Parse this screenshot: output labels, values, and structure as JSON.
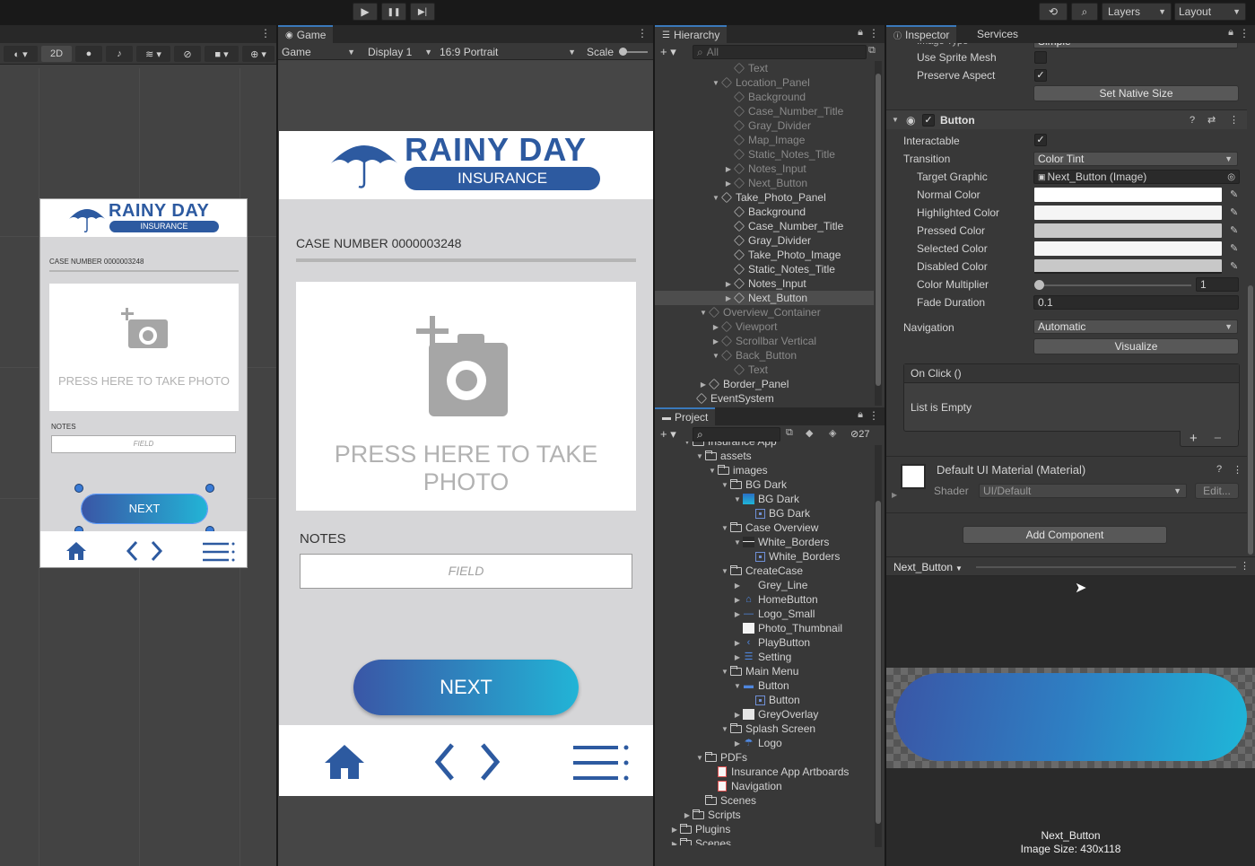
{
  "toolbar": {
    "play_icon": "▶",
    "pause_icon": "❚❚",
    "step_icon": "▶|",
    "layers_label": "Layers",
    "layout_label": "Layout"
  },
  "scene": {
    "mode_2d": "2D",
    "phone": {
      "logo_title": "RAINY DAY",
      "logo_subtitle": "INSURANCE",
      "case_number": "CASE NUMBER 0000003248",
      "photo_text": "PRESS HERE TO TAKE PHOTO",
      "notes_label": "NOTES",
      "field_placeholder": "FIELD",
      "next_label": "NEXT"
    }
  },
  "game": {
    "tab_label": "Game",
    "view_dropdown": "Game",
    "display_dropdown": "Display 1",
    "aspect_dropdown": "16:9 Portrait",
    "scale_label": "Scale",
    "app": {
      "logo_title": "RAINY DAY",
      "logo_subtitle": "INSURANCE",
      "case_number": "CASE NUMBER 0000003248",
      "photo_text": "PRESS HERE TO TAKE PHOTO",
      "notes_label": "NOTES",
      "field_placeholder": "FIELD",
      "next_label": "NEXT"
    }
  },
  "hierarchy": {
    "tab_label": "Hierarchy",
    "search_placeholder": "All",
    "items": [
      {
        "label": "Text",
        "indent": 5,
        "fold": "",
        "dim": true
      },
      {
        "label": "Location_Panel",
        "indent": 4,
        "fold": "▼",
        "dim": true
      },
      {
        "label": "Background",
        "indent": 5,
        "fold": "",
        "dim": true
      },
      {
        "label": "Case_Number_Title",
        "indent": 5,
        "fold": "",
        "dim": true
      },
      {
        "label": "Gray_Divider",
        "indent": 5,
        "fold": "",
        "dim": true
      },
      {
        "label": "Map_Image",
        "indent": 5,
        "fold": "",
        "dim": true
      },
      {
        "label": "Static_Notes_Title",
        "indent": 5,
        "fold": "",
        "dim": true
      },
      {
        "label": "Notes_Input",
        "indent": 5,
        "fold": "▶",
        "dim": true
      },
      {
        "label": "Next_Button",
        "indent": 5,
        "fold": "▶",
        "dim": true
      },
      {
        "label": "Take_Photo_Panel",
        "indent": 4,
        "fold": "▼",
        "dim": false
      },
      {
        "label": "Background",
        "indent": 5,
        "fold": "",
        "dim": false
      },
      {
        "label": "Case_Number_Title",
        "indent": 5,
        "fold": "",
        "dim": false
      },
      {
        "label": "Gray_Divider",
        "indent": 5,
        "fold": "",
        "dim": false
      },
      {
        "label": "Take_Photo_Image",
        "indent": 5,
        "fold": "",
        "dim": false
      },
      {
        "label": "Static_Notes_Title",
        "indent": 5,
        "fold": "",
        "dim": false
      },
      {
        "label": "Notes_Input",
        "indent": 5,
        "fold": "▶",
        "dim": false
      },
      {
        "label": "Next_Button",
        "indent": 5,
        "fold": "▶",
        "dim": false,
        "selected": true
      },
      {
        "label": "Overview_Container",
        "indent": 3,
        "fold": "▼",
        "dim": true
      },
      {
        "label": "Viewport",
        "indent": 4,
        "fold": "▶",
        "dim": true
      },
      {
        "label": "Scrollbar Vertical",
        "indent": 4,
        "fold": "▶",
        "dim": true
      },
      {
        "label": "Back_Button",
        "indent": 4,
        "fold": "▼",
        "dim": true
      },
      {
        "label": "Text",
        "indent": 5,
        "fold": "",
        "dim": true
      },
      {
        "label": "Border_Panel",
        "indent": 3,
        "fold": "▶",
        "dim": false
      },
      {
        "label": "EventSystem",
        "indent": 2,
        "fold": "",
        "dim": false
      }
    ]
  },
  "project": {
    "tab_label": "Project",
    "hidden_count": "27",
    "items": [
      {
        "label": "Insurance App",
        "indent": 1,
        "fold": "▼",
        "type": "folder"
      },
      {
        "label": "assets",
        "indent": 2,
        "fold": "▼",
        "type": "folder"
      },
      {
        "label": "images",
        "indent": 3,
        "fold": "▼",
        "type": "folder"
      },
      {
        "label": "BG Dark",
        "indent": 4,
        "fold": "▼",
        "type": "folder"
      },
      {
        "label": "BG Dark",
        "indent": 5,
        "fold": "▼",
        "type": "image-blue"
      },
      {
        "label": "BG Dark",
        "indent": 6,
        "fold": "",
        "type": "sprite"
      },
      {
        "label": "Case Overview",
        "indent": 4,
        "fold": "▼",
        "type": "folder"
      },
      {
        "label": "White_Borders",
        "indent": 5,
        "fold": "▼",
        "type": "image-lines"
      },
      {
        "label": "White_Borders",
        "indent": 6,
        "fold": "",
        "type": "sprite"
      },
      {
        "label": "CreateCase",
        "indent": 4,
        "fold": "▼",
        "type": "folder"
      },
      {
        "label": "Grey_Line",
        "indent": 5,
        "fold": "▶",
        "type": "blank"
      },
      {
        "label": "HomeButton",
        "indent": 5,
        "fold": "▶",
        "type": "home"
      },
      {
        "label": "Logo_Small",
        "indent": 5,
        "fold": "▶",
        "type": "logo"
      },
      {
        "label": "Photo_Thumbnail",
        "indent": 5,
        "fold": "",
        "type": "white"
      },
      {
        "label": "PlayButton",
        "indent": 5,
        "fold": "▶",
        "type": "chevron"
      },
      {
        "label": "Setting",
        "indent": 5,
        "fold": "▶",
        "type": "menu"
      },
      {
        "label": "Main Menu",
        "indent": 4,
        "fold": "▼",
        "type": "folder"
      },
      {
        "label": "Button",
        "indent": 5,
        "fold": "▼",
        "type": "bar"
      },
      {
        "label": "Button",
        "indent": 6,
        "fold": "",
        "type": "sprite"
      },
      {
        "label": "GreyOverlay",
        "indent": 5,
        "fold": "▶",
        "type": "grey"
      },
      {
        "label": "Splash Screen",
        "indent": 4,
        "fold": "▼",
        "type": "folder"
      },
      {
        "label": "Logo",
        "indent": 5,
        "fold": "▶",
        "type": "umbrella"
      },
      {
        "label": "PDFs",
        "indent": 2,
        "fold": "▼",
        "type": "folder"
      },
      {
        "label": "Insurance App Artboards",
        "indent": 3,
        "fold": "",
        "type": "pdf"
      },
      {
        "label": "Navigation",
        "indent": 3,
        "fold": "",
        "type": "pdf"
      },
      {
        "label": "Scenes",
        "indent": 2,
        "fold": "",
        "type": "folder"
      },
      {
        "label": "Scripts",
        "indent": 1,
        "fold": "▶",
        "type": "folder"
      },
      {
        "label": "Plugins",
        "indent": 0,
        "fold": "▶",
        "type": "folder"
      },
      {
        "label": "Scenes",
        "indent": 0,
        "fold": "▶",
        "type": "folder"
      }
    ]
  },
  "inspector": {
    "tab_label": "Inspector",
    "services_label": "Services",
    "image_type_label": "Image Type",
    "image_type_value": "Simple",
    "use_sprite_mesh": "Use Sprite Mesh",
    "preserve_aspect": "Preserve Aspect",
    "set_native_size": "Set Native Size",
    "component_title": "Button",
    "interactable_label": "Interactable",
    "transition_label": "Transition",
    "transition_value": "Color Tint",
    "target_graphic_label": "Target Graphic",
    "target_graphic_value": "Next_Button (Image)",
    "normal_color_label": "Normal Color",
    "highlighted_color_label": "Highlighted Color",
    "pressed_color_label": "Pressed Color",
    "selected_color_label": "Selected Color",
    "disabled_color_label": "Disabled Color",
    "color_multiplier_label": "Color Multiplier",
    "color_multiplier_value": "1",
    "fade_duration_label": "Fade Duration",
    "fade_duration_value": "0.1",
    "navigation_label": "Navigation",
    "navigation_value": "Automatic",
    "visualize_label": "Visualize",
    "onclick_label": "On Click ()",
    "list_empty": "List is Empty",
    "plus": "+",
    "minus": "−",
    "material_title": "Default UI Material (Material)",
    "shader_label": "Shader",
    "shader_value": "UI/Default",
    "edit_label": "Edit...",
    "add_component": "Add Component",
    "preview_name": "Next_Button",
    "preview_caption_name": "Next_Button",
    "preview_caption_size": "Image Size: 430x118",
    "colors": {
      "normal": "#ffffff",
      "highlighted": "#f5f5f5",
      "pressed": "#c8c8c8",
      "selected": "#f5f5f5",
      "disabled": "#c8c8c8"
    }
  }
}
